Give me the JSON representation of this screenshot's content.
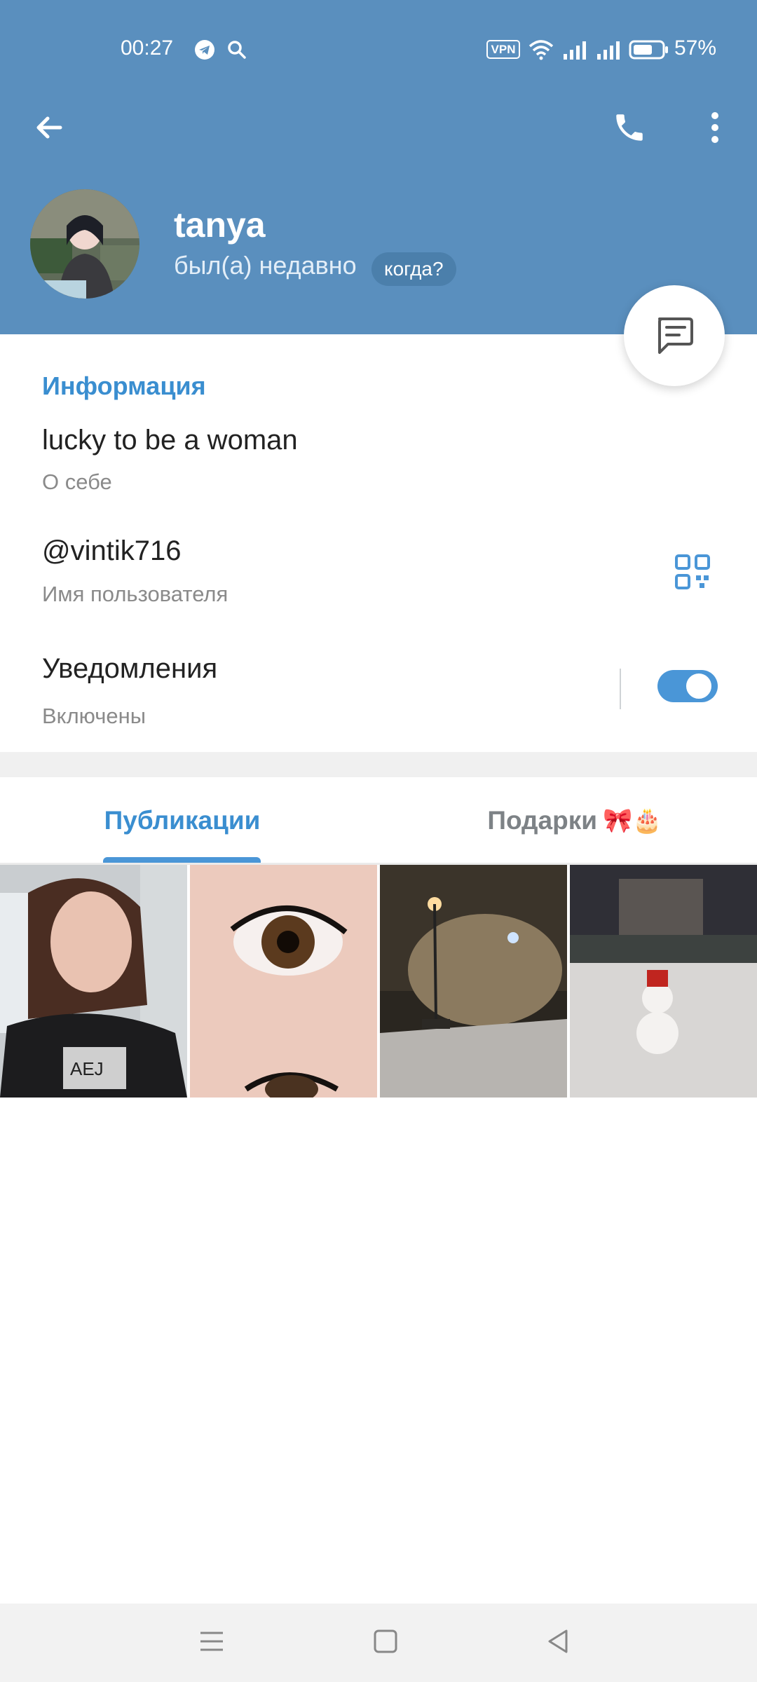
{
  "status_bar": {
    "time": "00:27",
    "vpn": "VPN",
    "battery": "57%"
  },
  "header": {
    "name": "tanya",
    "last_seen": "был(а) недавно",
    "when_label": "когда?"
  },
  "info": {
    "section_title": "Информация",
    "bio": "lucky to be a woman",
    "bio_label": "О себе",
    "username": "@vintik716",
    "username_label": "Имя пользователя",
    "notifications": "Уведомления",
    "notifications_state": "Включены",
    "notifications_on": true
  },
  "tabs": {
    "posts": "Публикации",
    "gifts": "Подарки",
    "gifts_emoji": "🎀🎂"
  },
  "colors": {
    "header_bg": "#5a8fbe",
    "accent": "#3a8ed0"
  }
}
